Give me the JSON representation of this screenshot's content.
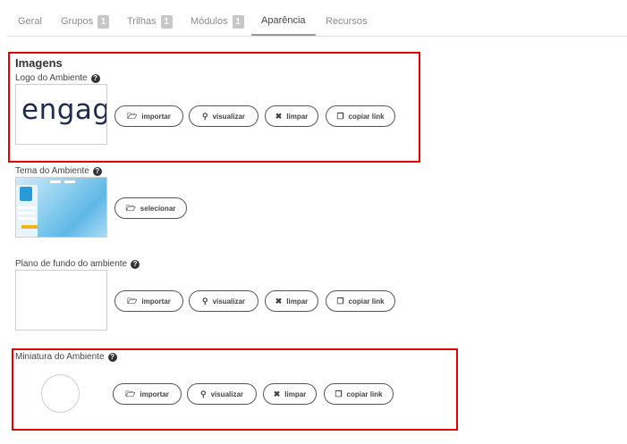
{
  "tabs": [
    {
      "label": "Geral",
      "count": null
    },
    {
      "label": "Grupos",
      "count": "1"
    },
    {
      "label": "Trilhas",
      "count": "1"
    },
    {
      "label": "Módulos",
      "count": "1"
    },
    {
      "label": "Aparência",
      "count": null,
      "active": true
    },
    {
      "label": "Recursos",
      "count": null
    }
  ],
  "section_title": "Imagens",
  "logo": {
    "label": "Logo do Ambiente",
    "preview_text": "engag",
    "buttons": {
      "import": "importar",
      "view": "visualizar",
      "clear": "limpar",
      "copy": "copiar link"
    }
  },
  "theme": {
    "label": "Tema do Ambiente",
    "buttons": {
      "select": "selecionar"
    }
  },
  "background": {
    "label": "Plano de fundo do ambiente",
    "buttons": {
      "import": "importar",
      "view": "visualizar",
      "clear": "limpar",
      "copy": "copiar link"
    }
  },
  "thumbnail": {
    "label": "Miniatura do Ambiente",
    "buttons": {
      "import": "importar",
      "view": "visualizar",
      "clear": "limpar",
      "copy": "copiar link"
    }
  },
  "colors": {
    "highlight": "#e00000",
    "logo": "#1e2a4f"
  }
}
